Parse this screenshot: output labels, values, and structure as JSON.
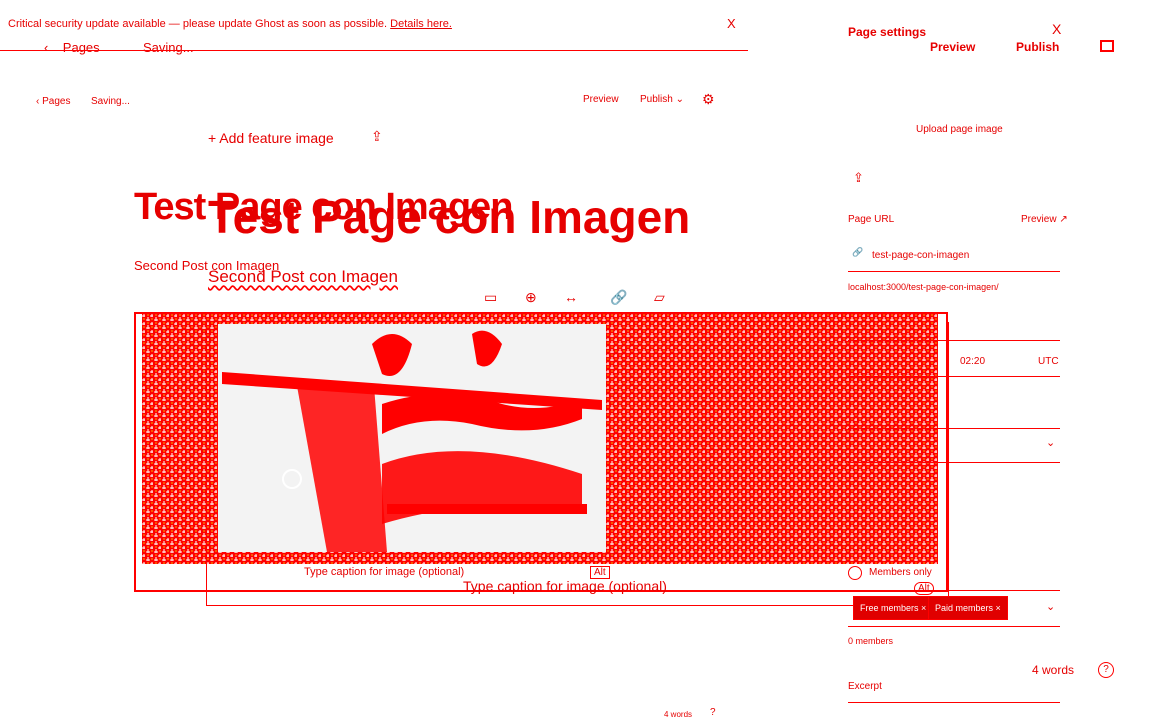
{
  "alert": {
    "message": "Critical security update available — please update Ghost as soon as possible.",
    "link": "Details here.",
    "close": "X"
  },
  "nav": {
    "back_label": "Pages",
    "back_arrow": "‹",
    "status": "Saving...",
    "preview": "Preview",
    "publish": "Publish",
    "publish_caret": "⌄",
    "settings_icon": "gear-icon",
    "settings_glyph": "⚙"
  },
  "editor": {
    "add_feature": "+ Add feature image",
    "upload_glyph": "⇪",
    "title": "Test Page con Imagen",
    "subtitle": "Second Post con Imagen",
    "image_toolbar": [
      "▭",
      "⊕",
      "↔",
      "🔗",
      "▱"
    ],
    "caption_placeholder": "Type caption for image (optional)",
    "alt": "Alt"
  },
  "panel": {
    "title": "Page settings",
    "close": "X",
    "preview": "Preview",
    "publish": "Publish",
    "upload": "Upload page image",
    "upload_glyph": "⇪",
    "url_label": "Page URL",
    "url_preview": "Preview ↗",
    "url_icon": "🔗",
    "url_value": "test-page-con-imagen",
    "url_full": "localhost:3000/test-page-con-imagen/",
    "time": "02:20",
    "timezone": "UTC",
    "chevron": "⌄",
    "access": "Members only",
    "tier_chips": [
      "Free members ×",
      "Paid members ×"
    ],
    "members_count": "0 members",
    "word_count": "4 words",
    "help": "?",
    "excerpt": "Excerpt"
  },
  "footer": {
    "word_count": "4 words",
    "help": "?"
  },
  "colors": {
    "accent": "#ff0000",
    "chip_bg": "#e00000",
    "background": "#ffffff"
  }
}
